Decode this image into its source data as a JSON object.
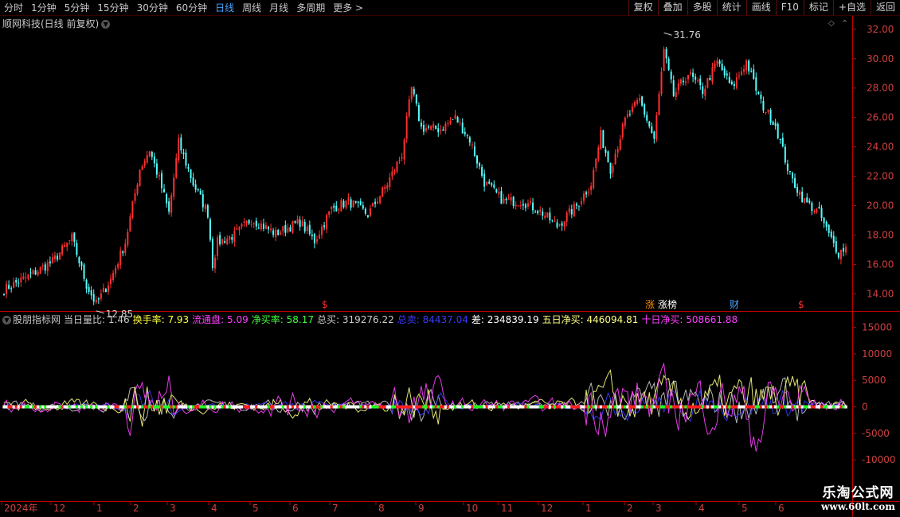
{
  "toolbar": {
    "tabs": [
      "分时",
      "1分钟",
      "5分钟",
      "15分钟",
      "30分钟",
      "60分钟",
      "日线",
      "周线",
      "月线",
      "多周期",
      "更多 >"
    ],
    "active_tab": "日线",
    "buttons": [
      "复权",
      "叠加",
      "多股",
      "统计",
      "画线",
      "F10",
      "标记",
      "+自选",
      "返回"
    ]
  },
  "stock": {
    "title": "顺网科技(日线 前复权)"
  },
  "indicator": {
    "name": "股朋指标网",
    "fields": [
      {
        "label": "当日量比:",
        "value": "1.46",
        "color": "#c8c8c8"
      },
      {
        "label": "换手率:",
        "value": "7.93",
        "color": "#ffff40"
      },
      {
        "label": "流通盘:",
        "value": "5.09",
        "color": "#ff40ff"
      },
      {
        "label": "净买率:",
        "value": "58.17",
        "color": "#40ff40"
      },
      {
        "label": "总买:",
        "value": "319276.22",
        "color": "#c8c8c8"
      },
      {
        "label": "总卖:",
        "value": "84437.04",
        "color": "#3a3aff"
      },
      {
        "label": "差:",
        "value": "234839.19",
        "color": "#ffffff"
      },
      {
        "label": "五日净买:",
        "value": "446094.81",
        "color": "#ffff80"
      },
      {
        "label": "十日净买:",
        "value": "508661.88",
        "color": "#ff40ff"
      }
    ]
  },
  "markers": [
    {
      "text": "$",
      "color": "#ff3030",
      "month": "5"
    },
    {
      "text": "涨",
      "color": "#ff8c00",
      "month": "3"
    },
    {
      "text": "涨榜",
      "color": "#ffffff",
      "month": "3"
    },
    {
      "text": "财",
      "color": "#4aa3ff",
      "month": "4"
    },
    {
      "text": "$",
      "color": "#ff3030",
      "month": "6"
    }
  ],
  "watermark": {
    "line1": "乐淘公式网",
    "line2": "www.60lt.com"
  },
  "chart_data": [
    {
      "type": "candlestick",
      "price_axis": {
        "ticks": [
          "14.00",
          "16.00",
          "18.00",
          "20.00",
          "22.00",
          "24.00",
          "26.00",
          "28.00",
          "30.00",
          "32.00"
        ],
        "range": [
          13.0,
          32.8
        ]
      },
      "annotations": [
        {
          "text": "31.76",
          "kind": "high"
        },
        {
          "text": "12.85",
          "kind": "low"
        }
      ],
      "anchors": [
        {
          "i": 0,
          "p": 14.3
        },
        {
          "i": 10,
          "p": 15.2
        },
        {
          "i": 20,
          "p": 16.2
        },
        {
          "i": 28,
          "p": 17.8
        },
        {
          "i": 34,
          "p": 14.6
        },
        {
          "i": 38,
          "p": 13.3
        },
        {
          "i": 44,
          "p": 15.0
        },
        {
          "i": 50,
          "p": 17.5
        },
        {
          "i": 56,
          "p": 22.5
        },
        {
          "i": 60,
          "p": 23.8
        },
        {
          "i": 64,
          "p": 21.8
        },
        {
          "i": 68,
          "p": 19.5
        },
        {
          "i": 72,
          "p": 24.3
        },
        {
          "i": 78,
          "p": 21.5
        },
        {
          "i": 84,
          "p": 19.5
        },
        {
          "i": 86,
          "p": 16.0
        },
        {
          "i": 88,
          "p": 17.5
        },
        {
          "i": 95,
          "p": 18.0
        },
        {
          "i": 102,
          "p": 19.1
        },
        {
          "i": 112,
          "p": 18.1
        },
        {
          "i": 122,
          "p": 18.9
        },
        {
          "i": 128,
          "p": 17.6
        },
        {
          "i": 135,
          "p": 19.8
        },
        {
          "i": 142,
          "p": 20.3
        },
        {
          "i": 150,
          "p": 19.4
        },
        {
          "i": 158,
          "p": 21.5
        },
        {
          "i": 164,
          "p": 23.5
        },
        {
          "i": 168,
          "p": 28.0
        },
        {
          "i": 172,
          "p": 25.3
        },
        {
          "i": 180,
          "p": 25.2
        },
        {
          "i": 186,
          "p": 26.0
        },
        {
          "i": 192,
          "p": 24.5
        },
        {
          "i": 198,
          "p": 21.6
        },
        {
          "i": 206,
          "p": 20.3
        },
        {
          "i": 214,
          "p": 20.3
        },
        {
          "i": 222,
          "p": 19.5
        },
        {
          "i": 228,
          "p": 18.6
        },
        {
          "i": 236,
          "p": 20.0
        },
        {
          "i": 242,
          "p": 21.5
        },
        {
          "i": 246,
          "p": 24.8
        },
        {
          "i": 250,
          "p": 22.5
        },
        {
          "i": 256,
          "p": 25.8
        },
        {
          "i": 262,
          "p": 27.2
        },
        {
          "i": 268,
          "p": 24.5
        },
        {
          "i": 272,
          "p": 30.5
        },
        {
          "i": 276,
          "p": 27.5
        },
        {
          "i": 282,
          "p": 29.0
        },
        {
          "i": 288,
          "p": 27.8
        },
        {
          "i": 294,
          "p": 29.8
        },
        {
          "i": 300,
          "p": 28.0
        },
        {
          "i": 306,
          "p": 29.8
        },
        {
          "i": 312,
          "p": 27.0
        },
        {
          "i": 318,
          "p": 25.5
        },
        {
          "i": 324,
          "p": 22.0
        },
        {
          "i": 330,
          "p": 20.3
        },
        {
          "i": 336,
          "p": 19.5
        },
        {
          "i": 340,
          "p": 18.0
        },
        {
          "i": 344,
          "p": 16.8
        },
        {
          "i": 347,
          "p": 17.2
        }
      ]
    },
    {
      "type": "line",
      "value_axis": {
        "ticks": [
          "15000",
          "10000",
          "5000",
          "0",
          "-5000",
          "-10000"
        ],
        "range": [
          -17500,
          16000
        ]
      },
      "series": [
        {
          "name": "总买",
          "color": "#c8c8c8"
        },
        {
          "name": "总卖",
          "color": "#3a3aff"
        },
        {
          "name": "五日净买",
          "color": "#ffff80"
        },
        {
          "name": "十日净买",
          "color": "#ff40ff"
        }
      ]
    }
  ],
  "time_axis": [
    "2024年",
    "12",
    "1",
    "2",
    "3",
    "4",
    "5",
    "6",
    "7",
    "8",
    "9",
    "10",
    "11",
    "12",
    "1",
    "2",
    "3",
    "4",
    "5",
    "6"
  ]
}
